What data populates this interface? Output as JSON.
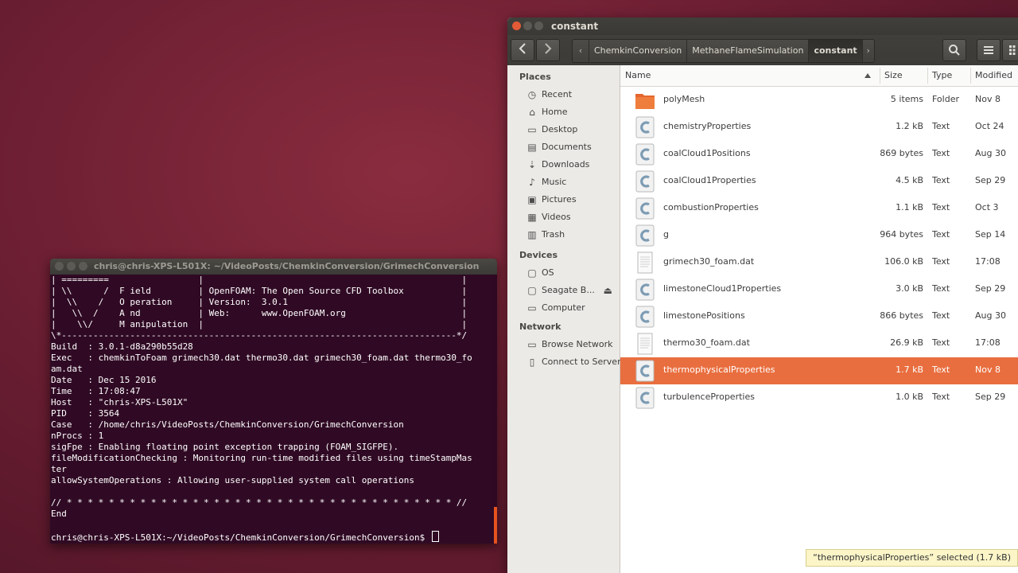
{
  "terminal": {
    "title": "chris@chris-XPS-L501X: ~/VideoPosts/ChemkinConversion/GrimechConversion",
    "lines": [
      "| =========                 |                                                 |",
      "| \\\\      /  F ield         | OpenFOAM: The Open Source CFD Toolbox           |",
      "|  \\\\    /   O peration     | Version:  3.0.1                                 |",
      "|   \\\\  /    A nd           | Web:      www.OpenFOAM.org                      |",
      "|    \\\\/     M anipulation  |                                                 |",
      "\\*---------------------------------------------------------------------------*/",
      "Build  : 3.0.1-d8a290b55d28",
      "Exec   : chemkinToFoam grimech30.dat thermo30.dat grimech30_foam.dat thermo30_fo",
      "am.dat",
      "Date   : Dec 15 2016",
      "Time   : 17:08:47",
      "Host   : \"chris-XPS-L501X\"",
      "PID    : 3564",
      "Case   : /home/chris/VideoPosts/ChemkinConversion/GrimechConversion",
      "nProcs : 1",
      "sigFpe : Enabling floating point exception trapping (FOAM_SIGFPE).",
      "fileModificationChecking : Monitoring run-time modified files using timeStampMas",
      "ter",
      "allowSystemOperations : Allowing user-supplied system call operations",
      "",
      "// * * * * * * * * * * * * * * * * * * * * * * * * * * * * * * * * * * * * * //",
      "End",
      ""
    ],
    "prompt": "chris@chris-XPS-L501X:~/VideoPosts/ChemkinConversion/GrimechConversion$ "
  },
  "files": {
    "title": "constant",
    "breadcrumbs": [
      "ChemkinConversion",
      "MethaneFlameSimulation",
      "constant"
    ],
    "sidebar": {
      "places_heading": "Places",
      "places": [
        {
          "label": "Recent",
          "icon": "recent-icon"
        },
        {
          "label": "Home",
          "icon": "home-icon"
        },
        {
          "label": "Desktop",
          "icon": "desktop-icon"
        },
        {
          "label": "Documents",
          "icon": "documents-icon"
        },
        {
          "label": "Downloads",
          "icon": "downloads-icon"
        },
        {
          "label": "Music",
          "icon": "music-icon"
        },
        {
          "label": "Pictures",
          "icon": "pictures-icon"
        },
        {
          "label": "Videos",
          "icon": "videos-icon"
        },
        {
          "label": "Trash",
          "icon": "trash-icon"
        }
      ],
      "devices_heading": "Devices",
      "devices": [
        {
          "label": "OS",
          "icon": "drive-icon"
        },
        {
          "label": "Seagate B...",
          "icon": "drive-icon"
        },
        {
          "label": "Computer",
          "icon": "computer-icon"
        }
      ],
      "network_heading": "Network",
      "network": [
        {
          "label": "Browse Network",
          "icon": "network-icon"
        },
        {
          "label": "Connect to Server",
          "icon": "server-icon"
        }
      ]
    },
    "columns": {
      "name": "Name",
      "size": "Size",
      "type": "Type",
      "modified": "Modified"
    },
    "rows": [
      {
        "name": "polyMesh",
        "size": "5 items",
        "type": "Folder",
        "modified": "Nov 8",
        "kind": "folder"
      },
      {
        "name": "chemistryProperties",
        "size": "1.2 kB",
        "type": "Text",
        "modified": "Oct 24",
        "kind": "c"
      },
      {
        "name": "coalCloud1Positions",
        "size": "869 bytes",
        "type": "Text",
        "modified": "Aug 30",
        "kind": "c"
      },
      {
        "name": "coalCloud1Properties",
        "size": "4.5 kB",
        "type": "Text",
        "modified": "Sep 29",
        "kind": "c"
      },
      {
        "name": "combustionProperties",
        "size": "1.1 kB",
        "type": "Text",
        "modified": "Oct 3",
        "kind": "c"
      },
      {
        "name": "g",
        "size": "964 bytes",
        "type": "Text",
        "modified": "Sep 14",
        "kind": "c"
      },
      {
        "name": "grimech30_foam.dat",
        "size": "106.0 kB",
        "type": "Text",
        "modified": "17:08",
        "kind": "text"
      },
      {
        "name": "limestoneCloud1Properties",
        "size": "3.0 kB",
        "type": "Text",
        "modified": "Sep 29",
        "kind": "c"
      },
      {
        "name": "limestonePositions",
        "size": "866 bytes",
        "type": "Text",
        "modified": "Aug 30",
        "kind": "c"
      },
      {
        "name": "thermo30_foam.dat",
        "size": "26.9 kB",
        "type": "Text",
        "modified": "17:08",
        "kind": "text"
      },
      {
        "name": "thermophysicalProperties",
        "size": "1.7 kB",
        "type": "Text",
        "modified": "Nov 8",
        "kind": "c",
        "selected": true
      },
      {
        "name": "turbulenceProperties",
        "size": "1.0 kB",
        "type": "Text",
        "modified": "Sep 29",
        "kind": "c"
      }
    ],
    "status": "“thermophysicalProperties” selected  (1.7 kB)"
  },
  "colors": {
    "selection": "#e96e3f",
    "terminal_bg": "#300a24",
    "folder": "#e4662e"
  }
}
